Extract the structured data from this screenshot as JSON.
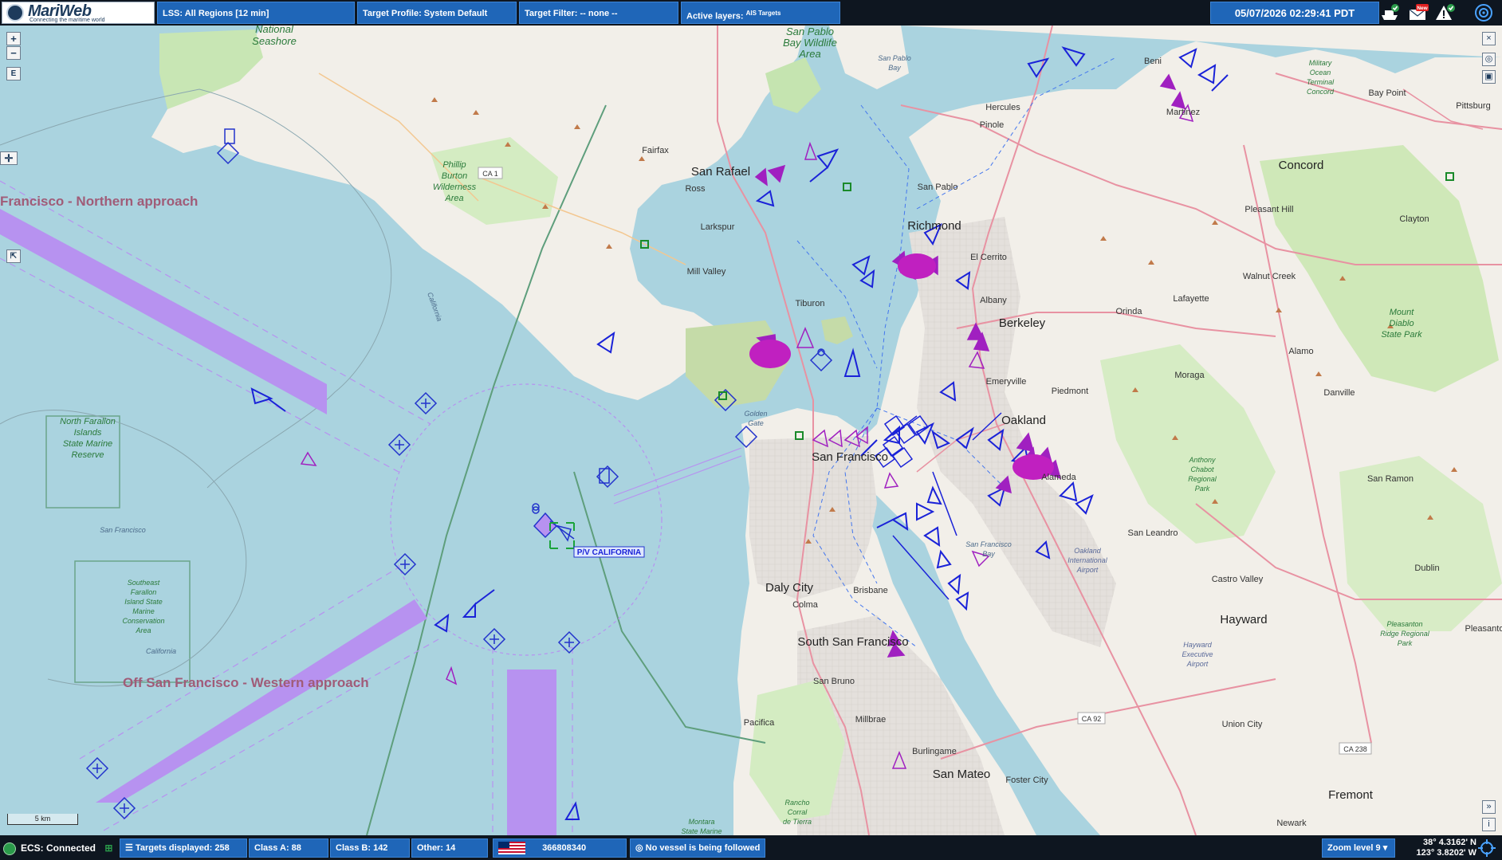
{
  "app": {
    "name": "MariWeb",
    "tagline": "Connecting the maritime world"
  },
  "topbar": {
    "lss": "LSS: All Regions [12 min]",
    "target_profile": "Target Profile: System Default",
    "target_filter": "Target Filter: -- none --",
    "active_layers_label": "Active layers:",
    "active_layers_value": "AIS Targets",
    "datetime": "05/07/2026 02:29:41 PDT",
    "new_badge": "New"
  },
  "map": {
    "approach_north": "Francisco - Northern approach",
    "approach_west": "Off San Francisco - Western approach",
    "vessel_label": "P/V CALIFORNIA",
    "parks": {
      "national_seashore": [
        "National",
        "Seashore"
      ],
      "phillip_burton": [
        "Phillip",
        "Burton",
        "Wilderness",
        "Area"
      ],
      "san_pablo_wildlife": [
        "San Pablo",
        "Bay Wildlife",
        "Area"
      ],
      "north_farallon": [
        "North Farallon",
        "Islands",
        "State Marine",
        "Reserve"
      ],
      "se_farallon": [
        "Southeast",
        "Farallon",
        "Island State",
        "Marine",
        "Conservation",
        "Area"
      ],
      "mount_diablo": [
        "Mount",
        "Diablo",
        "State Park"
      ],
      "anthony_chabot": [
        "Anthony",
        "Chabot",
        "Regional",
        "Park"
      ],
      "pleasanton_ridge": [
        "Pleasanton",
        "Ridge Regional",
        "Park"
      ],
      "rancho_corral": [
        "Rancho",
        "Corral",
        "de Tierra"
      ],
      "montara": [
        "Montara",
        "State Marine"
      ],
      "military_ocean": [
        "Military",
        "Ocean",
        "Terminal",
        "Concord"
      ]
    },
    "places": {
      "san_francisco": "San Francisco",
      "oakland": "Oakland",
      "berkeley": "Berkeley",
      "richmond": "Richmond",
      "san_rafael": "San Rafael",
      "concord": "Concord",
      "daly_city": "Daly City",
      "south_sf": "South San Francisco",
      "san_mateo": "San Mateo",
      "hayward": "Hayward",
      "fremont": "Fremont",
      "tiburon": "Tiburon",
      "mill_valley": "Mill Valley",
      "alameda": "Alameda",
      "emeryville": "Emeryville",
      "albany": "Albany",
      "el_cerrito": "El Cerrito",
      "san_pablo": "San Pablo",
      "pinole": "Pinole",
      "hercules": "Hercules",
      "martinez": "Martinez",
      "benicia": "Beni",
      "fairfax": "Fairfax",
      "ross": "Ross",
      "larkspur": "Larkspur",
      "lafayette": "Lafayette",
      "orinda": "Orinda",
      "moraga": "Moraga",
      "piedmont": "Piedmont",
      "walnut_creek": "Walnut Creek",
      "pleasant_hill": "Pleasant Hill",
      "clayton": "Clayton",
      "pittsburg": "Pittsburg",
      "bay_point": "Bay Point",
      "alamo": "Alamo",
      "danville": "Danville",
      "san_ramon": "San Ramon",
      "dublin": "Dublin",
      "pleasanton": "Pleasanto",
      "castro_valley": "Castro Valley",
      "san_leandro": "San Leandro",
      "union_city": "Union City",
      "newark": "Newark",
      "foster_city": "Foster City",
      "burlingame": "Burlingame",
      "millbrae": "Millbrae",
      "san_bruno": "San Bruno",
      "brisbane": "Brisbane",
      "colma": "Colma",
      "pacifica": "Pacifica",
      "golden_gate": [
        "Golden",
        "Gate"
      ],
      "san_francisco_bay": [
        "San Francisco",
        "Bay"
      ],
      "san_pablo_bay": [
        "San Pablo",
        "Bay"
      ],
      "sf_offshore": "San Francisco",
      "california_coast": "California",
      "california_south": "California",
      "oakland_airport": [
        "Oakland",
        "International",
        "Airport"
      ],
      "hayward_airport": [
        "Hayward",
        "Executive",
        "Airport"
      ]
    },
    "roads": {
      "ca1": "CA 1",
      "ca92": "CA 92",
      "ca238": "CA 238"
    },
    "scale": "5 km"
  },
  "bottombar": {
    "ecs_status": "ECS: Connected",
    "targets_displayed": "Targets displayed: 258",
    "class_a": "Class A: 88",
    "class_b": "Class B: 142",
    "other": "Other: 14",
    "mmsi": "366808340",
    "follow_status": "No vessel is being followed",
    "zoom": "Zoom level 9",
    "lat": "38° 4.3162' N",
    "lon": "123° 3.8202' W"
  }
}
